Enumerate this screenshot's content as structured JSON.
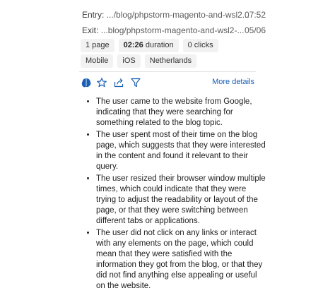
{
  "entry": {
    "label": "Entry:",
    "path": ".../blog/phpstorm-magento-and-wsl2...",
    "time": "07:52"
  },
  "exit": {
    "label": "Exit:",
    "path": "...blog/phpstorm-magento-and-wsl2-...",
    "time": "05/06"
  },
  "stats": {
    "pages": "1 page",
    "duration_value": "02:26",
    "duration_unit": "duration",
    "clicks": "0 clicks"
  },
  "tags": [
    "Mobile",
    "iOS",
    "Netherlands"
  ],
  "actions": {
    "icons": [
      "brain-icon",
      "star-icon",
      "share-icon",
      "filter-icon"
    ],
    "more_details": "More details"
  },
  "notes": [
    "The user came to the website from Google, indicating that they were searching for something related to the blog topic.",
    "The user spent most of their time on the blog page, which suggests that they were interested in the content and found it relevant to their query.",
    "The user resized their browser window multiple times, which could indicate that they were trying to adjust the readability or layout of the page, or that they were switching between different tabs or applications.",
    "The user did not click on any links or interact with any elements on the page, which could mean that they were satisfied with the information they got from the blog, or that they did not find anything else appealing or useful on the website."
  ],
  "colors": {
    "accent": "#1a5fb4",
    "chip_bg": "#f2f2f2"
  }
}
